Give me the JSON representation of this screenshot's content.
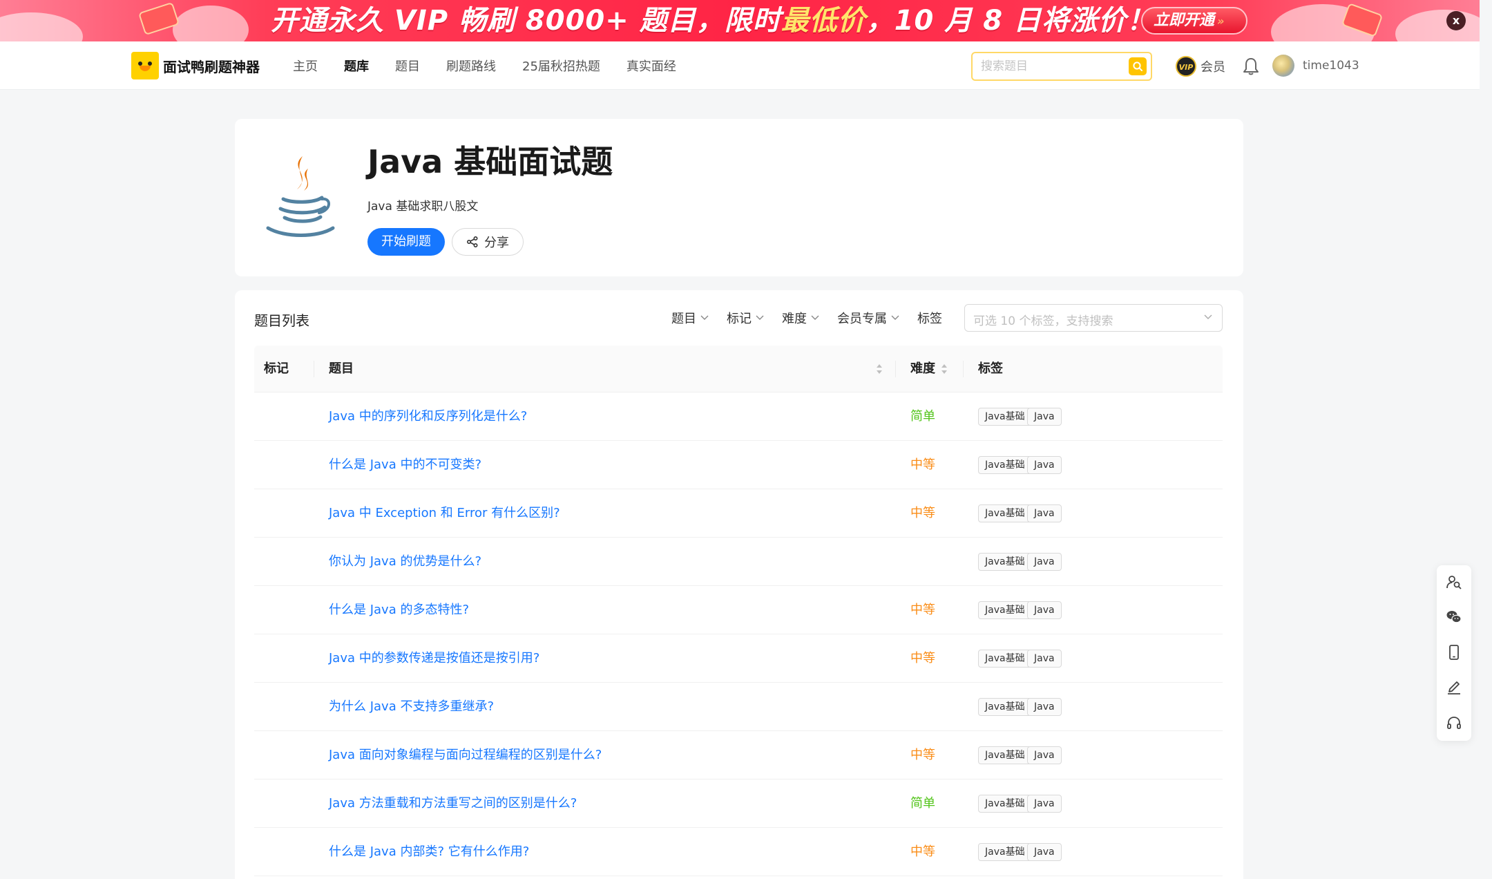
{
  "banner": {
    "text_before": "开通永久 VIP 畅刷 8000+ 题目，限时",
    "text_highlight": "最低价",
    "text_after": "，10 月 8 日将涨价！",
    "cta_label": "立即开通",
    "close_label": "x",
    "colors": {
      "background": "#ff2445",
      "highlight": "#ffe56b"
    }
  },
  "header": {
    "logo_text": "面试鸭刷题神器",
    "nav": [
      {
        "label": "主页",
        "active": false
      },
      {
        "label": "题库",
        "active": true
      },
      {
        "label": "题目",
        "active": false
      },
      {
        "label": "刷题路线",
        "active": false
      },
      {
        "label": "25届秋招热题",
        "active": false
      },
      {
        "label": "真实面经",
        "active": false
      }
    ],
    "search_placeholder": "搜索题目",
    "vip_badge": "VIP",
    "vip_label": "会员",
    "username": "time1043",
    "colors": {
      "accent": "#ffd100"
    }
  },
  "bank": {
    "title": "Java 基础面试题",
    "subtitle": "Java 基础求职八股文",
    "start_label": "开始刷题",
    "share_label": "分享",
    "icon": "java-coffee-cup-icon"
  },
  "list": {
    "title": "题目列表",
    "filters": [
      "题目",
      "标记",
      "难度",
      "会员专属"
    ],
    "tag_filter_label": "标签",
    "tag_placeholder": "可选 10 个标签，支持搜索",
    "columns": {
      "mark": "标记",
      "title": "题目",
      "difficulty": "难度",
      "tags": "标签"
    },
    "difficulty_colors": {
      "easy": "#52c41a",
      "medium": "#fa8c16"
    },
    "rows": [
      {
        "title": "Java 中的序列化和反序列化是什么?",
        "difficulty": "简单",
        "level": "easy",
        "tags": [
          "Java基础",
          "Java"
        ]
      },
      {
        "title": "什么是 Java 中的不可变类?",
        "difficulty": "中等",
        "level": "medium",
        "tags": [
          "Java基础",
          "Java"
        ]
      },
      {
        "title": "Java 中 Exception 和 Error 有什么区别?",
        "difficulty": "中等",
        "level": "medium",
        "tags": [
          "Java基础",
          "Java"
        ]
      },
      {
        "title": "你认为 Java 的优势是什么?",
        "difficulty": "",
        "level": "",
        "tags": [
          "Java基础",
          "Java"
        ]
      },
      {
        "title": "什么是 Java 的多态特性?",
        "difficulty": "中等",
        "level": "medium",
        "tags": [
          "Java基础",
          "Java"
        ]
      },
      {
        "title": "Java 中的参数传递是按值还是按引用?",
        "difficulty": "中等",
        "level": "medium",
        "tags": [
          "Java基础",
          "Java"
        ]
      },
      {
        "title": "为什么 Java 不支持多重继承?",
        "difficulty": "",
        "level": "",
        "tags": [
          "Java基础",
          "Java"
        ]
      },
      {
        "title": "Java 面向对象编程与面向过程编程的区别是什么?",
        "difficulty": "中等",
        "level": "medium",
        "tags": [
          "Java基础",
          "Java"
        ]
      },
      {
        "title": "Java 方法重载和方法重写之间的区别是什么?",
        "difficulty": "简单",
        "level": "easy",
        "tags": [
          "Java基础",
          "Java"
        ]
      },
      {
        "title": "什么是 Java 内部类? 它有什么作用?",
        "difficulty": "中等",
        "level": "medium",
        "tags": [
          "Java基础",
          "Java"
        ]
      }
    ]
  },
  "side_toolbar": {
    "icons": [
      "user-search-icon",
      "wechat-icon",
      "mobile-icon",
      "edit-icon",
      "headset-icon"
    ]
  }
}
